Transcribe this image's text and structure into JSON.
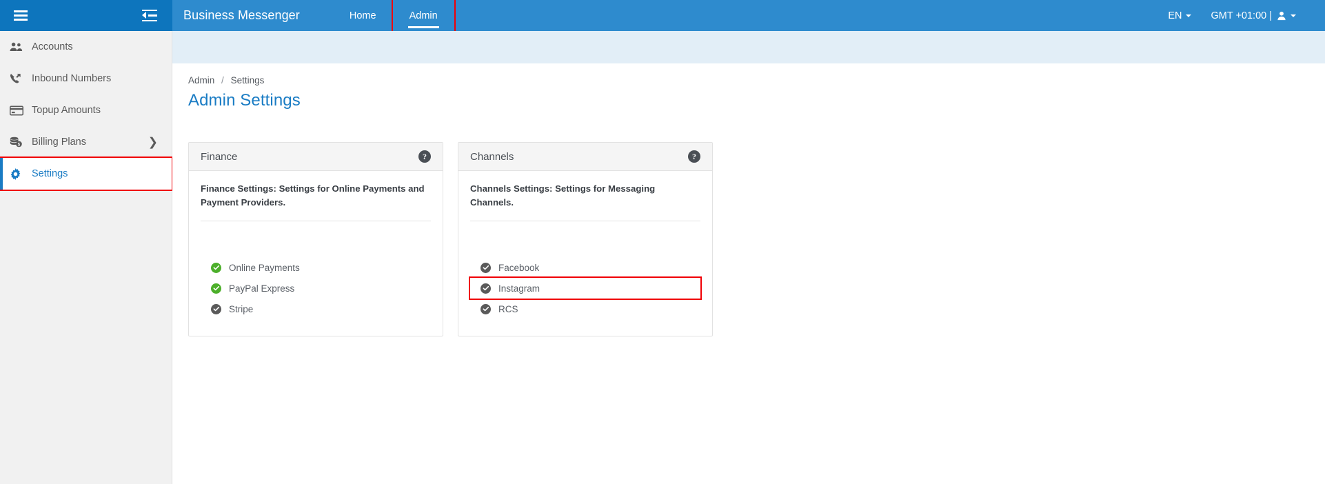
{
  "header": {
    "brand": "Business Messenger",
    "menu_icon": "hamburger-icon",
    "collapse_icon": "collapse-sidebar-icon",
    "tabs": [
      {
        "label": "Home",
        "active": false
      },
      {
        "label": "Admin",
        "active": true
      }
    ],
    "language": "EN",
    "timezone": "GMT +01:00 |",
    "user_icon": "user-avatar-icon",
    "accent_color": "#2e8bce",
    "left_color": "#0d75bd"
  },
  "sidebar": {
    "items": [
      {
        "label": "Accounts",
        "icon": "users-icon",
        "active": false,
        "chevron": false
      },
      {
        "label": "Inbound Numbers",
        "icon": "phone-incoming-icon",
        "active": false,
        "chevron": false
      },
      {
        "label": "Topup Amounts",
        "icon": "credit-card-icon",
        "active": false,
        "chevron": false
      },
      {
        "label": "Billing Plans",
        "icon": "coins-icon",
        "active": false,
        "chevron": true
      },
      {
        "label": "Settings",
        "icon": "gear-icon",
        "active": true,
        "chevron": false
      }
    ],
    "active_color": "#1a7cc4"
  },
  "main": {
    "breadcrumb": {
      "parent": "Admin",
      "separator": "/",
      "current": "Settings"
    },
    "page_title": "Admin Settings",
    "cards": [
      {
        "title": "Finance",
        "help_icon": "help-circle-icon",
        "description": "Finance Settings: Settings for Online Payments and Payment Providers.",
        "features": [
          {
            "label": "Online Payments",
            "state": "on"
          },
          {
            "label": "PayPal Express",
            "state": "on"
          },
          {
            "label": "Stripe",
            "state": "off"
          }
        ]
      },
      {
        "title": "Channels",
        "help_icon": "help-circle-icon",
        "description": "Channels Settings: Settings for Messaging Channels.",
        "features": [
          {
            "label": "Facebook",
            "state": "off"
          },
          {
            "label": "Instagram",
            "state": "off",
            "highlighted": true
          },
          {
            "label": "RCS",
            "state": "off"
          }
        ]
      }
    ]
  },
  "colors": {
    "highlight_box": "#f00005",
    "check_on": "#4caf2a",
    "check_off": "#5a5a5a"
  }
}
